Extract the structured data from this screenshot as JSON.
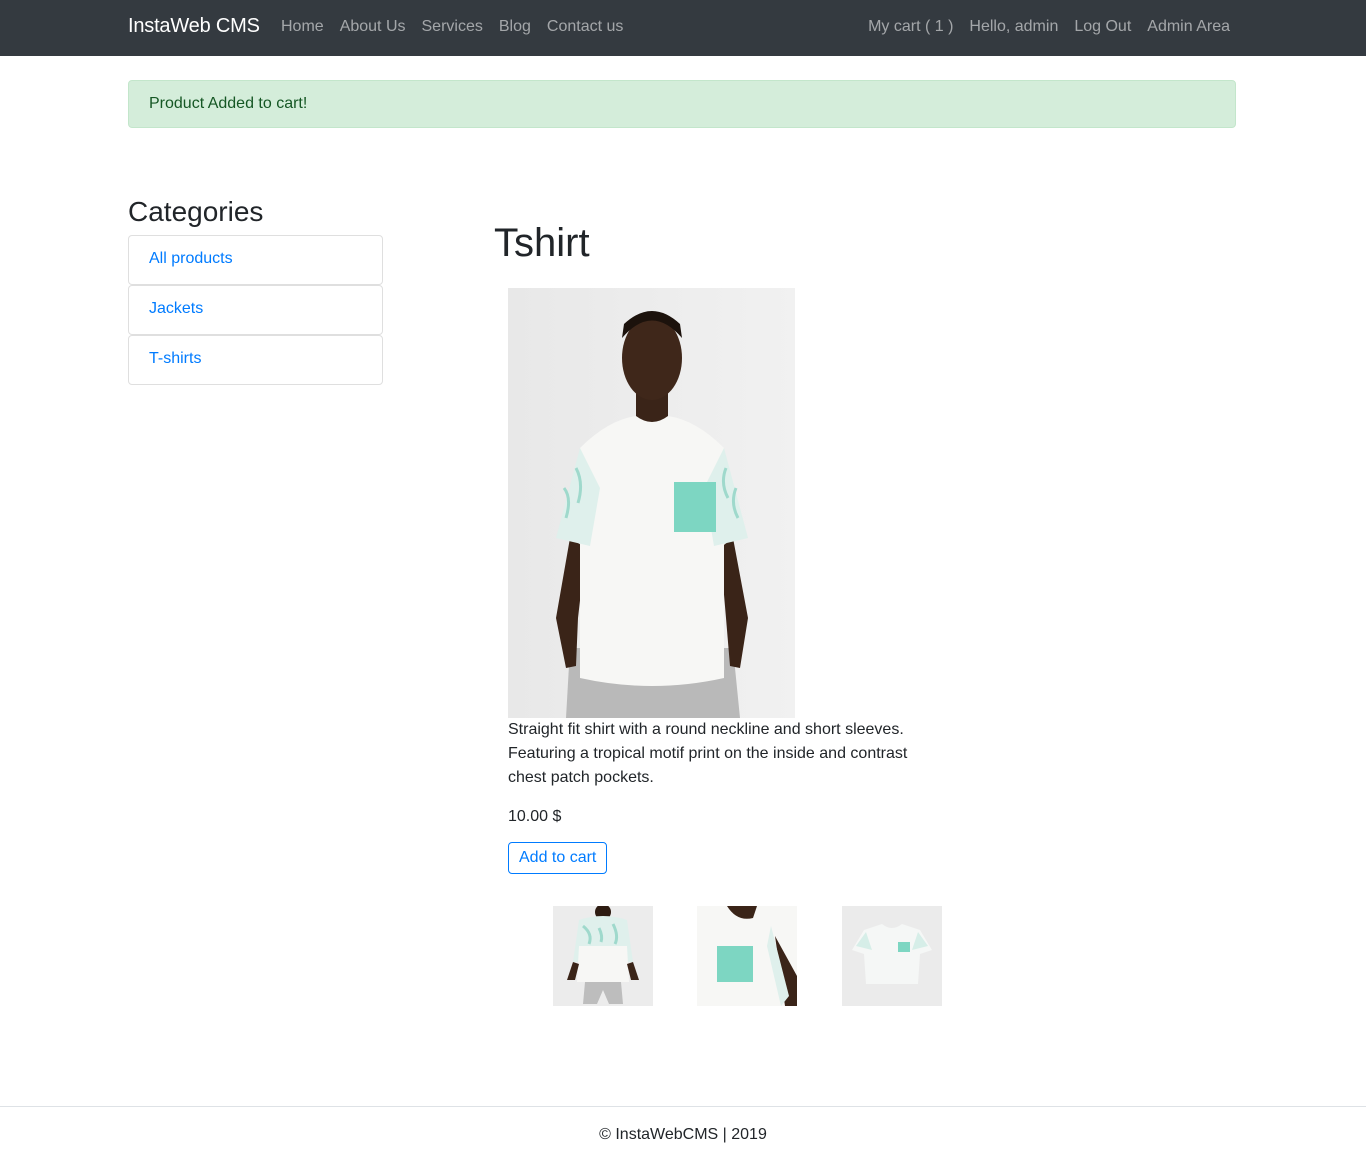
{
  "navbar": {
    "brand": "InstaWeb CMS",
    "left_links": [
      "Home",
      "About Us",
      "Services",
      "Blog",
      "Contact us"
    ],
    "cart": "My cart ( 1 )",
    "greeting": "Hello, admin",
    "logout": "Log Out",
    "admin": "Admin Area"
  },
  "alert": {
    "message": "Product Added to cart!"
  },
  "sidebar": {
    "title": "Categories",
    "items": [
      "All products",
      "Jackets",
      "T-shirts"
    ]
  },
  "product": {
    "title": "Tshirt",
    "description": "Straight fit shirt with a round neckline and short sleeves. Featuring a tropical motif print on the inside and contrast chest patch pockets.",
    "price": "10.00 $",
    "add_label": "Add to cart"
  },
  "footer": {
    "text": "© InstaWebCMS | 2019"
  },
  "colors": {
    "navbar_bg": "#343a40",
    "link": "#007bff",
    "alert_bg": "#d4edda",
    "alert_text": "#155724",
    "patch": "#7dd6c2"
  }
}
